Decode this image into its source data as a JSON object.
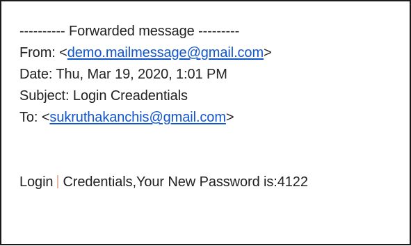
{
  "email": {
    "forward_header": "---------- Forwarded message ---------",
    "from_label": "From: <",
    "from_address": "demo.mailmessage@gmail.com",
    "from_close": ">",
    "date_line": "Date: Thu, Mar 19, 2020, 1:01 PM",
    "subject_line": "Subject: Login Creadentials",
    "to_label": "To: <",
    "to_address": "sukruthakanchis@gmail.com",
    "to_close": ">",
    "body_word_1": "Login",
    "body_rest": "Credentials,Your New Password is:4122"
  },
  "colors": {
    "link": "#1155cc",
    "text": "#222222",
    "border": "#1a1a1a"
  }
}
